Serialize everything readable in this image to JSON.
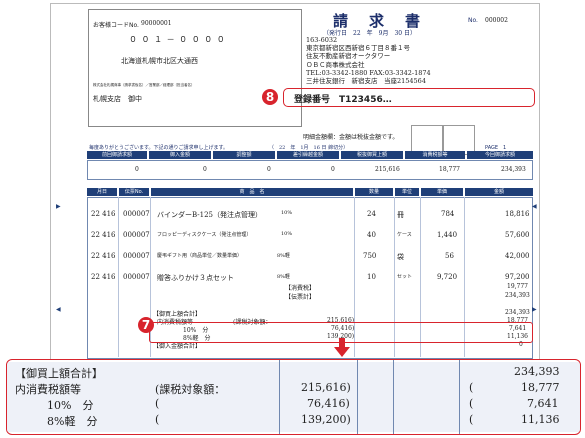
{
  "invoice": {
    "customer_code_label": "お客様コードNo.",
    "customer_code": "90000001",
    "postal_code": "０ ０ １ － ０ ０ ０ ０",
    "customer_address": "北海道札幌市北区大通西",
    "customer_company": "株式会社札幌商事（請求書仮名）／営業部／経理部（担当者名）",
    "customer_name": "札幌支店　御中",
    "title": "請　求　書",
    "date_label": "（発行日　22　年　9月　30 日）",
    "doc_no_label": "No.",
    "doc_no": "000002",
    "issuer_lines": [
      "163-6032",
      "東京都新宿区西新宿６丁目８番１号",
      "住友不動産新宿オークタワー",
      "ＯＢＣ商事株式会社",
      "TEL:03-3342-1880 FAX:03-3342-1874",
      "三井住友銀行　新宿支店　当座2154564"
    ],
    "registration": "登録番号　T123456…",
    "tax_note": "明細金額欄：金額は税抜金額です。",
    "thanks": "毎度ありがとうございます。下記の通りご請求申し上げます。",
    "period": "（　22　年　1月　16 日 締切分）",
    "page_label": "PAGE　1",
    "summary_headers": [
      "前回御請求額",
      "御入金額",
      "調整額",
      "差引繰越金額",
      "税抜御買上額",
      "消費税額等",
      "今回御請求額"
    ],
    "summary_values": [
      "0",
      "0",
      "0",
      "0",
      "215,616",
      "18,777",
      "234,393"
    ],
    "detail_headers": [
      "月日",
      "伝票No.",
      "商　品　名",
      "数量",
      "単位",
      "単価",
      "金額"
    ],
    "detail_rows": [
      {
        "date": "22 416",
        "no": "000007",
        "name": "バインダーB-125（発注点管理）",
        "rate": "10%",
        "qty": "24",
        "unit": "冊",
        "price": "784",
        "amount": "18,816"
      },
      {
        "date": "22 416",
        "no": "000007",
        "name": "フロッピーディスクケース（発注点管理）",
        "rate": "10%",
        "qty": "40",
        "unit": "ケース",
        "price": "1,440",
        "amount": "57,600"
      },
      {
        "date": "22 416",
        "no": "000007",
        "name": "慶弔ギフト用（商品単位／数量単価）",
        "rate": "8%軽",
        "qty": "750",
        "unit": "袋",
        "price": "56",
        "amount": "42,000"
      },
      {
        "date": "22 416",
        "no": "000007",
        "name": "贈答ふりかけ３点セット",
        "rate": "8%軽",
        "qty": "10",
        "unit": "セット",
        "price": "9,720",
        "amount": "97,200"
      }
    ],
    "consumption_tax_label": "【消費税】",
    "consumption_tax_value": "19,777",
    "slip_total_label": "【伝票計】",
    "slip_total_value": "234,393",
    "purchase_total_label": "【御買上額合計】",
    "purchase_total_value": "234,393",
    "tax_incl_label": "内消費税額等",
    "taxable_label": "(課税対象額：",
    "taxable_value": "215,616)",
    "tax_value": "18,777",
    "rate10_label": "10%　分",
    "rate10_base": "76,416)",
    "rate10_tax": "7,641",
    "rate8_label": "8%軽　分",
    "rate8_base": "139,200)",
    "rate8_tax": "11,136",
    "deposit_total_label": "【御入金額合計】",
    "deposit_total_value": "0"
  },
  "zoom": {
    "purchase_total_label": "【御買上額合計】",
    "purchase_total_value": "234,393",
    "tax_incl_label": "内消費税額等",
    "taxable_label": "(課税対象額：",
    "taxable_value": "215,616)",
    "tax_value": "18,777",
    "rate10_label": "10%　分",
    "rate10_paren": "(",
    "rate10_base": "76,416)",
    "rate10_tax": "7,641",
    "rate8_label": "8%軽　分",
    "rate8_paren": "(",
    "rate8_base": "139,200)",
    "rate8_tax": "11,136"
  },
  "markers": {
    "m7": "7",
    "m8": "8"
  },
  "colors": {
    "accent_red": "#d8242d",
    "header_navy": "#1f3f78"
  }
}
